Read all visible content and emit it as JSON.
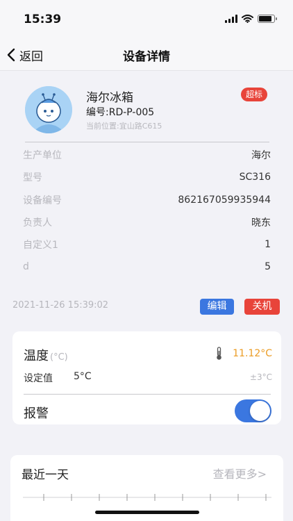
{
  "status_bar": {
    "time": "15:39",
    "battery_level": 0.85
  },
  "nav": {
    "back_label": "返回",
    "title": "设备详情"
  },
  "device": {
    "name": "海尔冰箱",
    "badge": "超标",
    "code": "编号:RD-P-005",
    "location": "当前位置:宜山路C615"
  },
  "info": [
    {
      "label": "生产单位",
      "value": "海尔"
    },
    {
      "label": "型号",
      "value": "SC316"
    },
    {
      "label": "设备编号",
      "value": "862167059935944"
    },
    {
      "label": "负责人",
      "value": "晓东"
    },
    {
      "label": "自定义1",
      "value": "1"
    },
    {
      "label": "d",
      "value": "5"
    }
  ],
  "timestamp": "2021-11-26 15:39:02",
  "actions": {
    "edit": "编辑",
    "power_off": "关机"
  },
  "temperature": {
    "label": "温度",
    "unit": "(°C)",
    "value": "11.12°C",
    "set_label": "设定值",
    "set_value": "5°C",
    "tolerance": "±3°C"
  },
  "alarm": {
    "label": "报警",
    "enabled": true
  },
  "chart_card": {
    "title": "最近一天",
    "more": "查看更多>"
  },
  "colors": {
    "accent_blue": "#3b77e0",
    "alert_red": "#e8443a",
    "temp_orange": "#eb9c24"
  }
}
